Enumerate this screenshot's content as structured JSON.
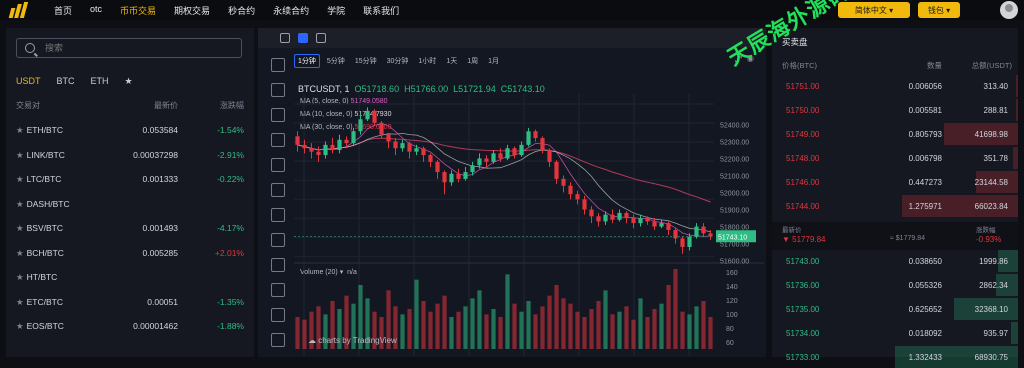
{
  "nav": {
    "items": [
      "首页",
      "otc",
      "币币交易",
      "期权交易",
      "秒合约",
      "永续合约",
      "学院",
      "联系我们"
    ],
    "active_index": 2,
    "language_label": "简体中文",
    "wallet_label": "钱包"
  },
  "market": {
    "search_placeholder": "搜索",
    "tabs": [
      "USDT",
      "BTC",
      "ETH",
      "★"
    ],
    "active_tab": 0,
    "headers": [
      "交易对",
      "最新价",
      "涨跌幅"
    ],
    "rows": [
      {
        "pair": "ETH/BTC",
        "price": "0.053584",
        "change": "-1.54%",
        "dir": "up"
      },
      {
        "pair": "LINK/BTC",
        "price": "0.00037298",
        "change": "-2.91%",
        "dir": "up"
      },
      {
        "pair": "LTC/BTC",
        "price": "0.001333",
        "change": "-0.22%",
        "dir": "up"
      },
      {
        "pair": "DASH/BTC",
        "price": "",
        "change": "",
        "dir": "up"
      },
      {
        "pair": "BSV/BTC",
        "price": "0.001493",
        "change": "-4.17%",
        "dir": "up"
      },
      {
        "pair": "BCH/BTC",
        "price": "0.005285",
        "change": "+2.01%",
        "dir": "down"
      },
      {
        "pair": "HT/BTC",
        "price": "",
        "change": "",
        "dir": "up"
      },
      {
        "pair": "ETC/BTC",
        "price": "0.00051",
        "change": "-1.35%",
        "dir": "up"
      },
      {
        "pair": "EOS/BTC",
        "price": "0.00001462",
        "change": "-1.88%",
        "dir": "up"
      }
    ]
  },
  "chart": {
    "timeframes": [
      "1分钟",
      "5分钟",
      "15分钟",
      "30分钟",
      "1小时",
      "1天",
      "1周",
      "1月"
    ],
    "active_timeframe": 0,
    "symbol_line": "BTCUSDT, 1",
    "open": "O51718.60",
    "high": "H51766.00",
    "low": "L51721.94",
    "close": "C51743.10",
    "ma5": "MA (5, close, 0)",
    "ma5_val": "51749.0580",
    "ma10": "MA (10, close, 0)",
    "ma10_val": "51724.7930",
    "ma30": "MA (30, close, 0)",
    "ma30_val": "51690.6000",
    "volume_label": "Volume (20)",
    "volume_val": "n/a",
    "brand": "charts by TradingView",
    "current_price_tag": "51743.10",
    "price_ticks": [
      "52400.00",
      "52300.00",
      "52200.00",
      "52100.00",
      "52000.00",
      "51900.00",
      "51800.00",
      "51700.00",
      "51600.00"
    ],
    "vol_ticks": [
      "160",
      "140",
      "120",
      "100",
      "80",
      "60"
    ]
  },
  "chart_data": {
    "type": "candlestick",
    "ylim": [
      51580,
      52520
    ],
    "candles": [
      [
        52330,
        52280,
        52360,
        52240
      ],
      [
        52280,
        52260,
        52310,
        52230
      ],
      [
        52260,
        52240,
        52290,
        52200
      ],
      [
        52240,
        52220,
        52270,
        52180
      ],
      [
        52220,
        52280,
        52300,
        52200
      ],
      [
        52280,
        52250,
        52320,
        52230
      ],
      [
        52250,
        52310,
        52340,
        52230
      ],
      [
        52310,
        52290,
        52330,
        52260
      ],
      [
        52290,
        52360,
        52380,
        52280
      ],
      [
        52360,
        52430,
        52460,
        52340
      ],
      [
        52430,
        52480,
        52500,
        52420
      ],
      [
        52480,
        52410,
        52490,
        52390
      ],
      [
        52410,
        52340,
        52420,
        52320
      ],
      [
        52340,
        52300,
        52350,
        52260
      ],
      [
        52300,
        52260,
        52320,
        52220
      ],
      [
        52260,
        52290,
        52310,
        52240
      ],
      [
        52290,
        52240,
        52300,
        52200
      ],
      [
        52240,
        52260,
        52280,
        52220
      ],
      [
        52260,
        52220,
        52270,
        52180
      ],
      [
        52220,
        52180,
        52230,
        52150
      ],
      [
        52180,
        52120,
        52190,
        52080
      ],
      [
        52120,
        52060,
        52130,
        51990
      ],
      [
        52060,
        52110,
        52130,
        52040
      ],
      [
        52110,
        52080,
        52140,
        52060
      ],
      [
        52080,
        52120,
        52150,
        52070
      ],
      [
        52120,
        52160,
        52180,
        52100
      ],
      [
        52160,
        52200,
        52230,
        52140
      ],
      [
        52200,
        52180,
        52220,
        52150
      ],
      [
        52180,
        52230,
        52250,
        52170
      ],
      [
        52230,
        52200,
        52260,
        52180
      ],
      [
        52200,
        52260,
        52280,
        52190
      ],
      [
        52260,
        52220,
        52270,
        52200
      ],
      [
        52220,
        52280,
        52300,
        52210
      ],
      [
        52280,
        52360,
        52380,
        52270
      ],
      [
        52360,
        52320,
        52370,
        52300
      ],
      [
        52320,
        52250,
        52330,
        52230
      ],
      [
        52250,
        52180,
        52260,
        52150
      ],
      [
        52180,
        52080,
        52190,
        52050
      ],
      [
        52080,
        52040,
        52100,
        52000
      ],
      [
        52040,
        51990,
        52060,
        51960
      ],
      [
        51990,
        51960,
        52010,
        51930
      ],
      [
        51960,
        51900,
        51980,
        51870
      ],
      [
        51900,
        51860,
        51920,
        51820
      ],
      [
        51860,
        51830,
        51880,
        51800
      ],
      [
        51830,
        51870,
        51890,
        51810
      ],
      [
        51870,
        51840,
        51900,
        51820
      ],
      [
        51840,
        51880,
        51900,
        51830
      ],
      [
        51880,
        51850,
        51890,
        51820
      ],
      [
        51850,
        51820,
        51870,
        51790
      ],
      [
        51820,
        51850,
        51870,
        51800
      ],
      [
        51850,
        51830,
        51860,
        51810
      ],
      [
        51830,
        51800,
        51850,
        51780
      ],
      [
        51800,
        51820,
        51840,
        51790
      ],
      [
        51820,
        51780,
        51830,
        51750
      ],
      [
        51780,
        51730,
        51790,
        51700
      ],
      [
        51730,
        51680,
        51740,
        51640
      ],
      [
        51680,
        51740,
        51760,
        51660
      ],
      [
        51740,
        51800,
        51820,
        51730
      ],
      [
        51800,
        51760,
        51820,
        51740
      ],
      [
        51760,
        51743,
        51780,
        51720
      ]
    ],
    "volume": [
      60,
      55,
      70,
      80,
      65,
      90,
      75,
      100,
      85,
      120,
      95,
      70,
      60,
      110,
      80,
      65,
      75,
      130,
      90,
      70,
      85,
      100,
      60,
      70,
      80,
      95,
      110,
      65,
      75,
      60,
      140,
      85,
      70,
      90,
      65,
      80,
      100,
      120,
      95,
      85,
      70,
      60,
      75,
      90,
      110,
      65,
      70,
      80,
      55,
      95,
      60,
      75,
      85,
      120,
      150,
      70,
      65,
      80,
      90,
      60
    ]
  },
  "orderbook": {
    "title": "买卖盘",
    "headers": [
      "价格(BTC)",
      "数量",
      "总额(USDT)"
    ],
    "asks": [
      {
        "price": "51751.00",
        "qty": "0.006056",
        "total": "313.40",
        "depth": 0.01
      },
      {
        "price": "51750.00",
        "qty": "0.005581",
        "total": "288.81",
        "depth": 0.01
      },
      {
        "price": "51749.00",
        "qty": "0.805793",
        "total": "41698.98",
        "depth": 0.3
      },
      {
        "price": "51748.00",
        "qty": "0.006798",
        "total": "351.78",
        "depth": 0.02
      },
      {
        "price": "51746.00",
        "qty": "0.447273",
        "total": "23144.58",
        "depth": 0.17
      },
      {
        "price": "51744.00",
        "qty": "1.275971",
        "total": "66023.84",
        "depth": 0.47
      }
    ],
    "mid": {
      "latest_label": "最新价",
      "change_label": "涨跌幅",
      "price": "51779.84",
      "usd": "≈ $1779.84",
      "change": "-0.93%"
    },
    "bids": [
      {
        "price": "51743.00",
        "qty": "0.038650",
        "total": "1999.86",
        "depth": 0.08
      },
      {
        "price": "51736.00",
        "qty": "0.055326",
        "total": "2862.34",
        "depth": 0.09
      },
      {
        "price": "51735.00",
        "qty": "0.625652",
        "total": "32368.10",
        "depth": 0.26
      },
      {
        "price": "51734.00",
        "qty": "0.018092",
        "total": "935.97",
        "depth": 0.03
      },
      {
        "price": "51733.00",
        "qty": "1.332433",
        "total": "68930.75",
        "depth": 0.5
      }
    ]
  },
  "watermark": "天辰海外源码网 tcym.cc"
}
